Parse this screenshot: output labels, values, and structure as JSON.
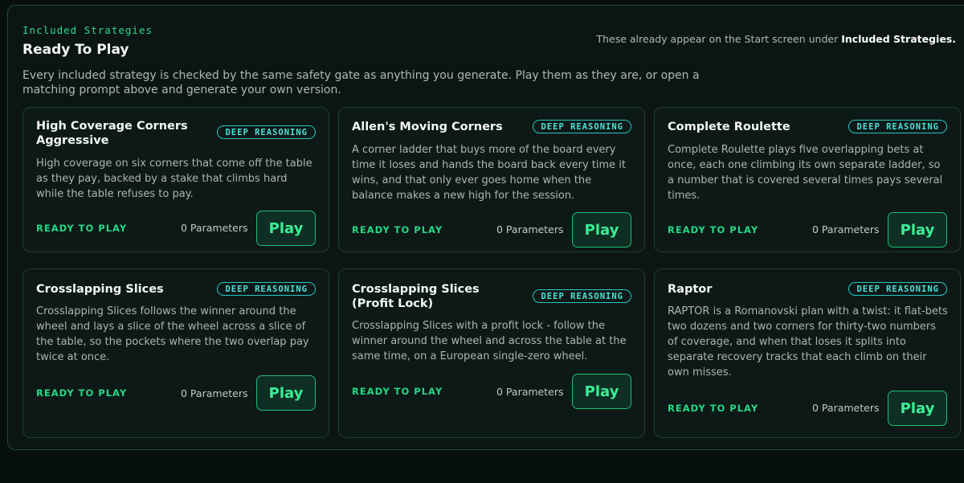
{
  "section": {
    "eyebrow": "Included Strategies",
    "title": "Ready To Play",
    "note_prefix": "These already appear on the Start screen under ",
    "note_bold": "Included Strategies.",
    "intro": "Every included strategy is checked by the same safety gate as anything you generate. Play them as they are, or open a matching prompt above and generate your own version."
  },
  "cards": [
    {
      "title": "High Coverage Corners Aggressive",
      "badge": "DEEP REASONING",
      "description": "High coverage on six corners that come off the table as they pay, backed by a stake that climbs hard while the table refuses to pay.",
      "status": "READY TO PLAY",
      "parameters": "0 Parameters",
      "play_label": "Play"
    },
    {
      "title": "Allen's Moving Corners",
      "badge": "DEEP REASONING",
      "description": "A corner ladder that buys more of the board every time it loses and hands the board back every time it wins, and that only ever goes home when the balance makes a new high for the session.",
      "status": "READY TO PLAY",
      "parameters": "0 Parameters",
      "play_label": "Play"
    },
    {
      "title": "Complete Roulette",
      "badge": "DEEP REASONING",
      "description": "Complete Roulette plays five overlapping bets at once, each one climbing its own separate ladder, so a number that is covered several times pays several times.",
      "status": "READY TO PLAY",
      "parameters": "0 Parameters",
      "play_label": "Play"
    },
    {
      "title": "Crosslapping Slices",
      "badge": "DEEP REASONING",
      "description": "Crosslapping Slices follows the winner around the wheel and lays a slice of the wheel across a slice of the table, so the pockets where the two overlap pay twice at once.",
      "status": "READY TO PLAY",
      "parameters": "0 Parameters",
      "play_label": "Play"
    },
    {
      "title": "Crosslapping Slices (Profit Lock)",
      "badge": "DEEP REASONING",
      "description": "Crosslapping Slices with a profit lock - follow the winner around the wheel and across the table at the same time, on a European single-zero wheel.",
      "status": "READY TO PLAY",
      "parameters": "0 Parameters",
      "play_label": "Play"
    },
    {
      "title": "Raptor",
      "badge": "DEEP REASONING",
      "description": "RAPTOR is a Romanovski plan with a twist: it flat-bets two dozens and two corners for thirty-two numbers of coverage, and when that loses it splits into separate recovery tracks that each climb on their own misses.",
      "status": "READY TO PLAY",
      "parameters": "0 Parameters",
      "play_label": "Play"
    }
  ]
}
